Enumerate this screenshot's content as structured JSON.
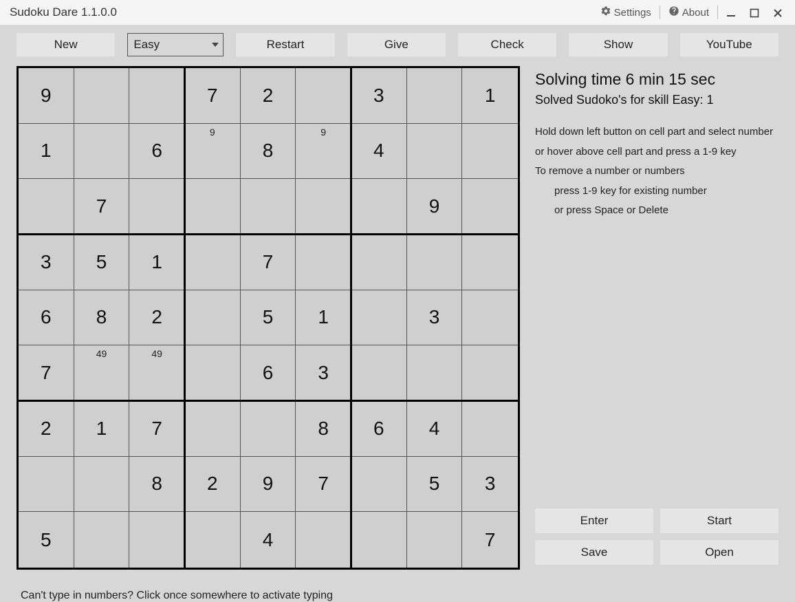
{
  "window": {
    "title": "Sudoku Dare 1.1.0.0",
    "settings": "Settings",
    "about": "About"
  },
  "toolbar": {
    "new": "New",
    "difficulty_selected": "Easy",
    "restart": "Restart",
    "give": "Give",
    "check": "Check",
    "show": "Show",
    "youtube": "YouTube"
  },
  "sidebar": {
    "time_line": "Solving time 6 min 15 sec",
    "solved_line": "Solved Sudoko's for skill Easy: 1",
    "help1": "Hold down left button on cell part and select number",
    "help2": "or hover above cell part and press a 1-9 key",
    "help3": "To remove a number or numbers",
    "help4": "press 1-9 key for existing number",
    "help5": "or press Space or Delete",
    "enter": "Enter",
    "start": "Start",
    "save": "Save",
    "open": "Open"
  },
  "footer": {
    "hint": "Can't type in numbers? Click once somewhere to activate typing"
  },
  "board": {
    "cells": [
      [
        {
          "v": "9"
        },
        {
          "v": ""
        },
        {
          "v": ""
        },
        {
          "v": "7"
        },
        {
          "v": "2"
        },
        {
          "v": ""
        },
        {
          "v": "3"
        },
        {
          "v": ""
        },
        {
          "v": "1"
        }
      ],
      [
        {
          "v": "1"
        },
        {
          "v": ""
        },
        {
          "v": "6"
        },
        {
          "v": "",
          "p": "9"
        },
        {
          "v": "8"
        },
        {
          "v": "",
          "p": "9"
        },
        {
          "v": "4"
        },
        {
          "v": ""
        },
        {
          "v": ""
        }
      ],
      [
        {
          "v": ""
        },
        {
          "v": "7"
        },
        {
          "v": ""
        },
        {
          "v": ""
        },
        {
          "v": ""
        },
        {
          "v": ""
        },
        {
          "v": ""
        },
        {
          "v": "9"
        },
        {
          "v": ""
        }
      ],
      [
        {
          "v": "3"
        },
        {
          "v": "5"
        },
        {
          "v": "1"
        },
        {
          "v": ""
        },
        {
          "v": "7"
        },
        {
          "v": ""
        },
        {
          "v": ""
        },
        {
          "v": ""
        },
        {
          "v": ""
        }
      ],
      [
        {
          "v": "6"
        },
        {
          "v": "8"
        },
        {
          "v": "2"
        },
        {
          "v": ""
        },
        {
          "v": "5"
        },
        {
          "v": "1"
        },
        {
          "v": ""
        },
        {
          "v": "3"
        },
        {
          "v": ""
        }
      ],
      [
        {
          "v": "7"
        },
        {
          "v": "",
          "p": "49"
        },
        {
          "v": "",
          "p": "49"
        },
        {
          "v": ""
        },
        {
          "v": "6"
        },
        {
          "v": "3"
        },
        {
          "v": ""
        },
        {
          "v": ""
        },
        {
          "v": ""
        }
      ],
      [
        {
          "v": "2"
        },
        {
          "v": "1"
        },
        {
          "v": "7"
        },
        {
          "v": ""
        },
        {
          "v": ""
        },
        {
          "v": "8"
        },
        {
          "v": "6"
        },
        {
          "v": "4"
        },
        {
          "v": ""
        }
      ],
      [
        {
          "v": ""
        },
        {
          "v": ""
        },
        {
          "v": "8"
        },
        {
          "v": "2"
        },
        {
          "v": "9"
        },
        {
          "v": "7"
        },
        {
          "v": ""
        },
        {
          "v": "5"
        },
        {
          "v": "3"
        }
      ],
      [
        {
          "v": "5"
        },
        {
          "v": ""
        },
        {
          "v": ""
        },
        {
          "v": ""
        },
        {
          "v": "4"
        },
        {
          "v": ""
        },
        {
          "v": ""
        },
        {
          "v": ""
        },
        {
          "v": "7"
        }
      ]
    ]
  }
}
